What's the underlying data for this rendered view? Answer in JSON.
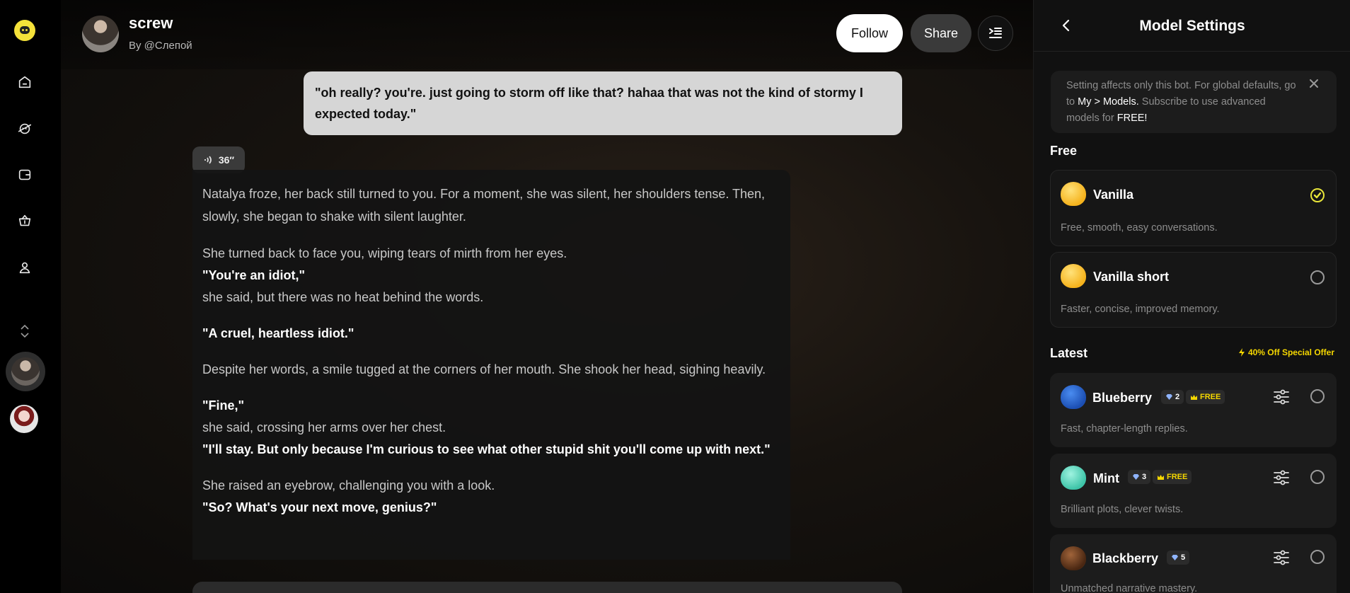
{
  "bot": {
    "name": "screw",
    "byline": "By  @Слепой",
    "follow_label": "Follow",
    "share_label": "Share"
  },
  "chat": {
    "user_message": "\"oh really? you're. just going to storm off like that? hahaa that was not the kind of stormy I expected today.\"",
    "voice_duration": "36″",
    "bot_paragraphs": [
      "Natalya froze, her back still turned to you. For a moment, she was silent, her shoulders tense. Then, slowly, she began to shake with silent laughter.",
      "She turned back to face you, wiping tears of mirth from her eyes.",
      "\"You're an idiot,\"",
      "she said, but there was no heat behind the words.",
      "\"A cruel, heartless idiot.\"",
      "Despite her words, a smile tugged at the corners of her mouth. She shook her head, sighing heavily.",
      "\"Fine,\"",
      "she said, crossing her arms over her chest.",
      "\"I'll stay. But only because I'm curious to see what other stupid shit you'll come up with next.\"",
      "She raised an eyebrow, challenging you with a look.",
      "\"So? What's your next move, genius?\""
    ]
  },
  "panel": {
    "title": "Model Settings",
    "notice": {
      "part1": "Setting affects only this bot. For global defaults, go to ",
      "link": "My > Models.",
      "part2": " Subscribe to use advanced models for ",
      "free": "FREE!"
    },
    "free_heading": "Free",
    "latest_heading": "Latest",
    "offer": "40% Off Special Offer",
    "free_models": [
      {
        "name": "Vanilla",
        "desc": "Free, smooth, easy conversations.",
        "selected": true
      },
      {
        "name": "Vanilla short",
        "desc": "Faster, concise, improved memory.",
        "selected": false
      }
    ],
    "latest_models": [
      {
        "name": "Blueberry",
        "gem": "2",
        "badge": "FREE",
        "desc": "Fast, chapter-length replies."
      },
      {
        "name": "Mint",
        "gem": "3",
        "badge": "FREE",
        "desc": "Brilliant plots, clever twists."
      },
      {
        "name": "Blackberry",
        "gem": "5",
        "badge": "",
        "desc": "Unmatched narrative mastery."
      }
    ]
  },
  "colors": {
    "accent": "#e8e63a",
    "offer": "#f5d700",
    "bubble_user": "#d6d6d6",
    "panel_bg": "#111111"
  },
  "icons": [
    "app-logo-icon",
    "home-icon",
    "planet-icon",
    "wallet-icon",
    "basket-icon",
    "user-icon",
    "chevron-updown-icon",
    "menu-collapse-icon",
    "back-icon",
    "close-icon",
    "check-icon",
    "tune-icon",
    "gem-icon",
    "crown-icon",
    "volume-icon",
    "lightning-icon"
  ]
}
